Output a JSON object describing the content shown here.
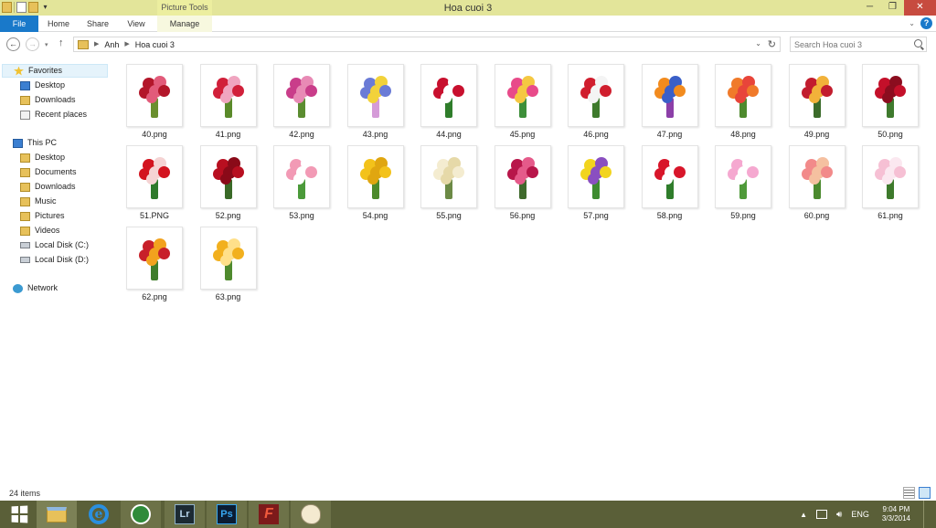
{
  "window": {
    "title": "Hoa cuoi 3"
  },
  "ribbon": {
    "context_label": "Picture Tools",
    "tabs": [
      "File",
      "Home",
      "Share",
      "View",
      "Manage"
    ]
  },
  "address": {
    "crumbs": [
      "Anh",
      "Hoa cuoi 3"
    ]
  },
  "search": {
    "placeholder": "Search Hoa cuoi 3"
  },
  "nav": {
    "favorites": "Favorites",
    "fav_items": [
      "Desktop",
      "Downloads",
      "Recent places"
    ],
    "this_pc": "This PC",
    "pc_items": [
      "Desktop",
      "Documents",
      "Downloads",
      "Music",
      "Pictures",
      "Videos",
      "Local Disk (C:)",
      "Local Disk (D:)"
    ],
    "network": "Network"
  },
  "files": [
    "40.png",
    "41.png",
    "42.png",
    "43.png",
    "44.png",
    "45.png",
    "46.png",
    "47.png",
    "48.png",
    "49.png",
    "50.png",
    "51.PNG",
    "52.png",
    "53.png",
    "54.png",
    "55.png",
    "56.png",
    "57.png",
    "58.png",
    "59.png",
    "60.png",
    "61.png",
    "62.png",
    "63.png"
  ],
  "status": {
    "count": "24 items"
  },
  "taskbar": {
    "lang": "ENG",
    "time": "9:04 PM",
    "date": "3/3/2014",
    "lr_label": "Lr",
    "ps_label": "Ps",
    "flash_label": "F",
    "ie_label": "e"
  },
  "colors": {
    "title_bar": "#e3e59a",
    "file_tab": "#1979ca",
    "taskbar": "#5a5f38",
    "close": "#c74b3f"
  }
}
